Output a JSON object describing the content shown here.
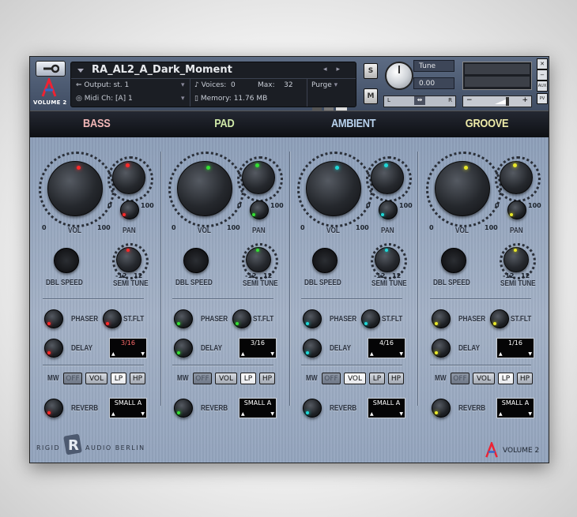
{
  "header": {
    "instrument_name": "RA_AL2_A_Dark_Moment",
    "output_label": "Output:",
    "output_value": "st. 1",
    "midi_label": "Midi Ch:",
    "midi_value": "[A]  1",
    "voices_label": "Voices:",
    "voices_value": "0",
    "max_label": "Max:",
    "max_value": "32",
    "purge_label": "Purge",
    "memory_label": "Memory:",
    "memory_value": "11.76 MB",
    "s_label": "S",
    "m_label": "M",
    "tune_label": "Tune",
    "tune_value": "0.00",
    "pan_l": "L",
    "pan_r": "R",
    "logo_text": "VOLUME 2",
    "side_aux": "AUX",
    "side_pv": "PV"
  },
  "tabs": [
    {
      "label": "BASS",
      "color": "#f1b6b6"
    },
    {
      "label": "PAD",
      "color": "#cfe9a8"
    },
    {
      "label": "AMBIENT",
      "color": "#b9d3ee"
    },
    {
      "label": "GROOVE",
      "color": "#eeeba8"
    }
  ],
  "labels": {
    "vol": "VOL",
    "pan": "PAN",
    "dbl_speed": "DBL SPEED",
    "semi_tune": "SEMI TUNE",
    "phaser": "PHASER",
    "st_flt": "ST.FLT",
    "delay": "DELAY",
    "mw": "MW",
    "reverb": "REVERB",
    "zero": "0",
    "hundred": "100",
    "minus12": "-12",
    "plus12": "12",
    "off": "OFF",
    "vol_btn": "VOL",
    "lp": "LP",
    "hp": "HP"
  },
  "sections": [
    {
      "name": "BASS",
      "led": "#ff2a2a",
      "delay_time": "3/16",
      "reverb_type": "SMALL A",
      "mw_active": "LP"
    },
    {
      "name": "PAD",
      "led": "#33e033",
      "delay_time": "3/16",
      "reverb_type": "SMALL A",
      "mw_active": "LP"
    },
    {
      "name": "AMBIENT",
      "led": "#1fd8d8",
      "delay_time": "4/16",
      "reverb_type": "SMALL A",
      "mw_active": "VOL"
    },
    {
      "name": "GROOVE",
      "led": "#e8e82a",
      "delay_time": "1/16",
      "reverb_type": "SMALL A",
      "mw_active": "LP"
    }
  ],
  "footer": {
    "brand_left": "RIGID",
    "brand_right": "AUDIO BERLIN",
    "volume": "VOLUME 2"
  }
}
